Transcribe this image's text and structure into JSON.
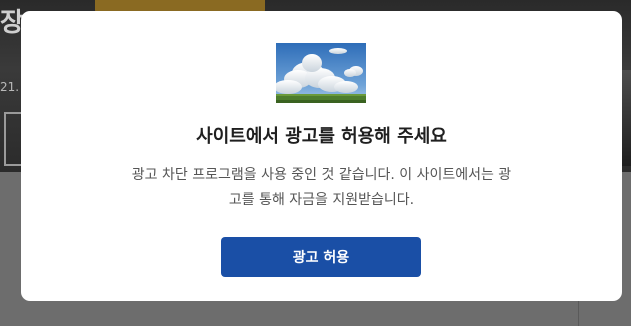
{
  "background": {
    "headline_fragment": "장",
    "date_fragment": "21."
  },
  "modal": {
    "image_icon": "sky-clouds-image",
    "title": "사이트에서 광고를 허용해 주세요",
    "description_line1": "광고 차단 프로그램을 사용 중인 것 같습니다. 이 사이트에서는 광",
    "description_line2": "고를 통해 자금을 지원받습니다.",
    "allow_button_label": "광고 허용",
    "accent_color": "#1a4fa6"
  }
}
